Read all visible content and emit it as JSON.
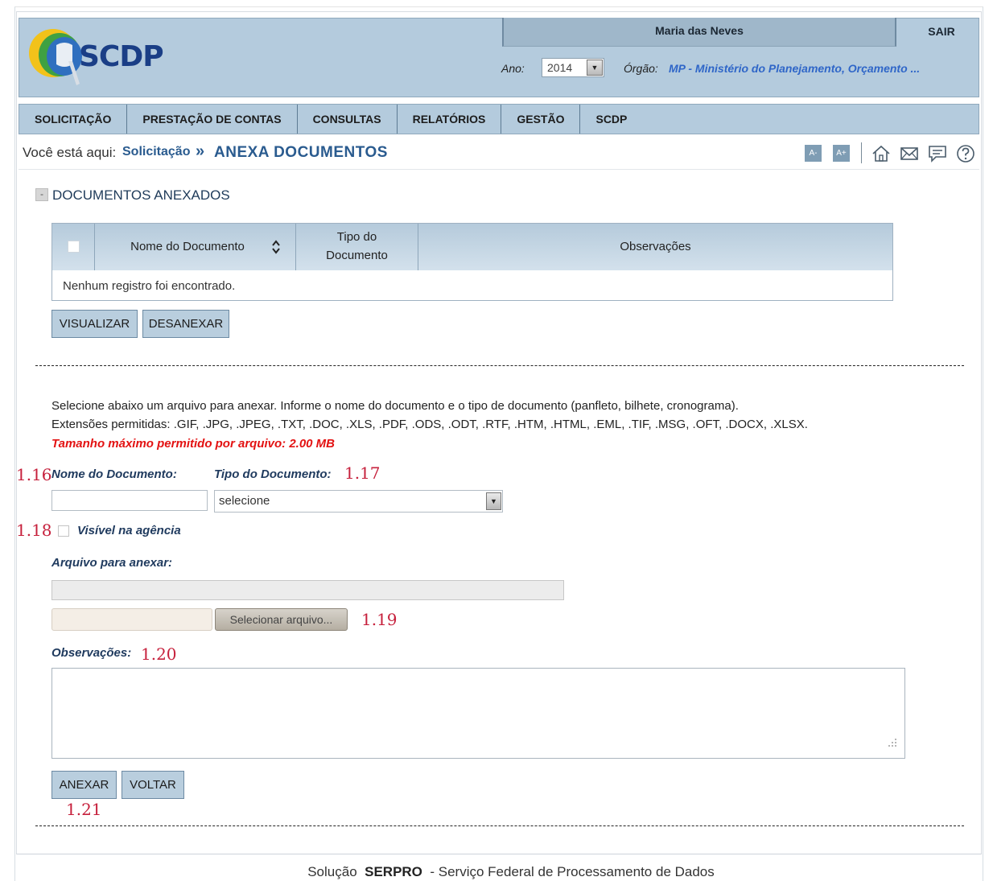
{
  "header": {
    "logo_text": "SCDP",
    "user_name": "Maria das Neves",
    "logout_label": "SAIR",
    "year_label": "Ano:",
    "year_value": "2014",
    "org_label": "Órgão:",
    "org_value": "MP - Ministério do Planejamento, Orçamento ..."
  },
  "menu": {
    "items": [
      {
        "label": "SOLICITAÇÃO"
      },
      {
        "label": "PRESTAÇÃO DE CONTAS"
      },
      {
        "label": "CONSULTAS"
      },
      {
        "label": "RELATÓRIOS"
      },
      {
        "label": "GESTÃO"
      },
      {
        "label": "SCDP"
      }
    ]
  },
  "breadcrumb": {
    "prefix": "Você está aqui:",
    "link": "Solicitação",
    "separator": "»",
    "current": "ANEXA DOCUMENTOS"
  },
  "toolbar": {
    "font_decrease": "A-",
    "font_increase": "A+",
    "icons": [
      "home-icon",
      "mail-icon",
      "chat-icon",
      "help-icon"
    ]
  },
  "section": {
    "title": "DOCUMENTOS ANEXADOS",
    "collapse_symbol": "-"
  },
  "table": {
    "columns": [
      "Nome do Documento",
      "Tipo do\nDocumento",
      "Observações"
    ],
    "col_name": "Nome do Documento",
    "col_type_line1": "Tipo do",
    "col_type_line2": "Documento",
    "col_obs": "Observações",
    "empty_message": "Nenhum registro foi encontrado."
  },
  "table_actions": {
    "view_label": "VISUALIZAR",
    "detach_label": "DESANEXAR"
  },
  "instructions": {
    "line1": "Selecione abaixo um arquivo para anexar. Informe o nome do documento e o tipo de documento (panfleto, bilhete, cronograma).",
    "line2": "Extensões permitidas: .GIF, .JPG, .JPEG, .TXT, .DOC, .XLS, .PDF, .ODS, .ODT, .RTF, .HTM, .HTML, .EML, .TIF, .MSG, .OFT, .DOCX, .XLSX.",
    "max_size": "Tamanho máximo permitido por arquivo: 2.00 MB"
  },
  "form": {
    "doc_name_label": "Nome do Documento:",
    "doc_name_value": "",
    "doc_type_label": "Tipo do Documento:",
    "doc_type_value": "selecione",
    "visible_label": "Visível na agência",
    "visible_checked": false,
    "file_label": "Arquivo para anexar:",
    "file_button": "Selecionar arquivo...",
    "obs_label": "Observações:",
    "obs_value": ""
  },
  "form_actions": {
    "attach_label": "ANEXAR",
    "back_label": "VOLTAR"
  },
  "annotations": {
    "a116": "1.16",
    "a117": "1.17",
    "a118": "1.18",
    "a119": "1.19",
    "a120": "1.20",
    "a121": "1.21"
  },
  "footer": {
    "prefix": "Solução",
    "brand": "SERPRO",
    "suffix": "- Serviço Federal de Processamento de Dados"
  },
  "colors": {
    "header_bg": "#b4cbdd",
    "title_blue": "#2a5b8f",
    "label_blue": "#1f3a5e",
    "warning_red": "#e31212",
    "annotation_red": "#c6203c"
  }
}
